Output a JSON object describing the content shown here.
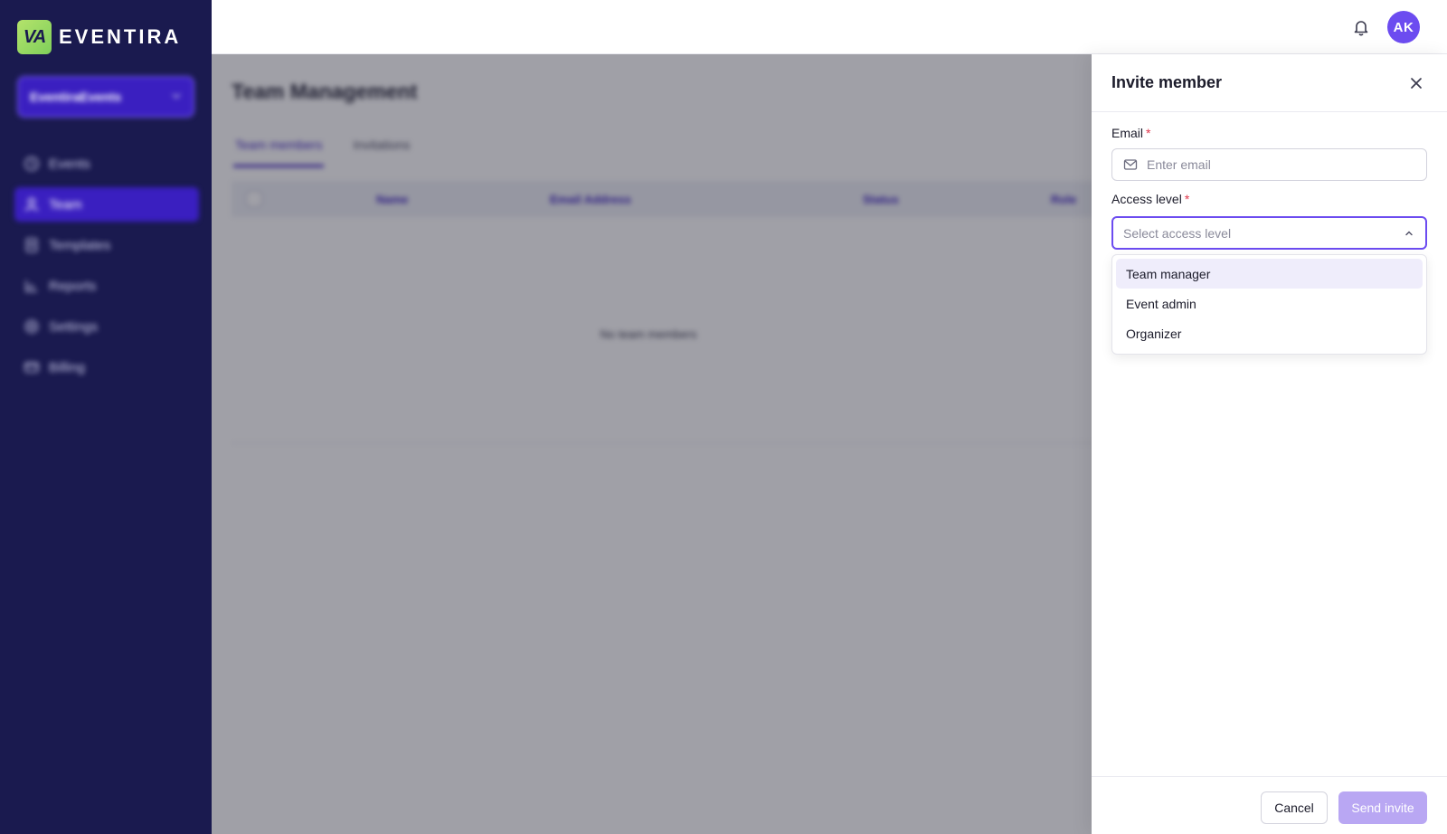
{
  "brand": {
    "logo_mark": "VA",
    "name": "EVENTIRA",
    "logo_color": "#9ddb63"
  },
  "sidebar": {
    "workspace": "EventiraEvents",
    "items": [
      {
        "label": "Events",
        "icon": "clock-icon"
      },
      {
        "label": "Team",
        "icon": "user-icon",
        "active": true
      },
      {
        "label": "Templates",
        "icon": "document-icon"
      },
      {
        "label": "Reports",
        "icon": "chart-icon"
      },
      {
        "label": "Settings",
        "icon": "gear-icon"
      },
      {
        "label": "Billing",
        "icon": "card-icon"
      }
    ]
  },
  "topbar": {
    "avatar_initials": "AK",
    "accent": "#6c4cf0"
  },
  "main": {
    "title": "Team Management",
    "tabs": [
      "Team members",
      "Invitations"
    ],
    "columns": [
      "Name",
      "Email Address",
      "Status",
      "Role"
    ],
    "empty_text": "No team members"
  },
  "drawer": {
    "title": "Invite member",
    "email": {
      "label": "Email",
      "required_mark": "*",
      "placeholder": "Enter email",
      "value": ""
    },
    "access": {
      "label": "Access level",
      "required_mark": "*",
      "placeholder": "Select access level"
    },
    "options": [
      "Team manager",
      "Event admin",
      "Organizer"
    ],
    "highlighted_option": "Team manager",
    "cancel_label": "Cancel",
    "send_label": "Send invite"
  }
}
